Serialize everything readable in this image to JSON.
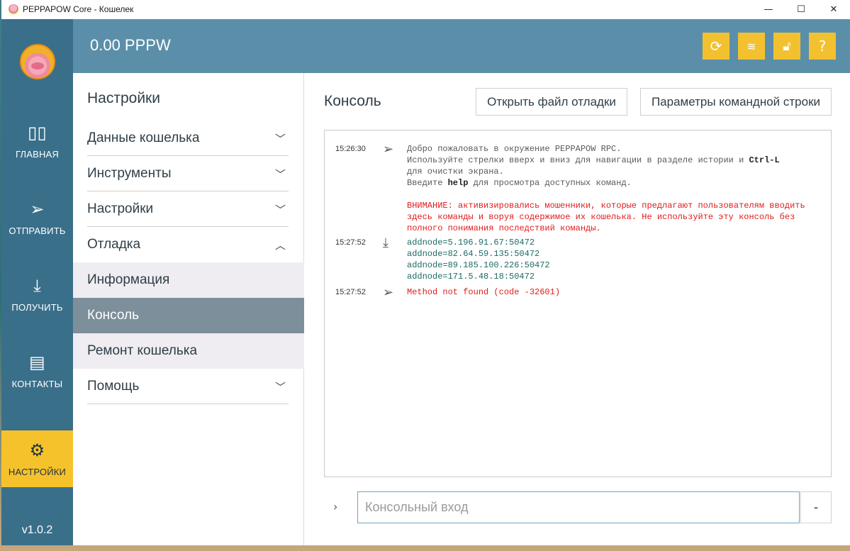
{
  "window": {
    "title": "PEPPAPOW Core - Кошелек",
    "minimize": "—",
    "maximize": "☐",
    "close": "✕"
  },
  "nav": {
    "items": [
      {
        "label": "ГЛАВНАЯ",
        "icon": "overview-icon"
      },
      {
        "label": "ОТПРАВИТЬ",
        "icon": "send-icon"
      },
      {
        "label": "ПОЛУЧИТЬ",
        "icon": "receive-icon"
      },
      {
        "label": "КОНТАКТЫ",
        "icon": "contacts-icon"
      },
      {
        "label": "НАСТРОЙКИ",
        "icon": "settings-icon"
      }
    ],
    "version": "v1.0.2"
  },
  "header": {
    "balance": "0.00 PPPW",
    "buttons": [
      "sync-icon",
      "network-icon",
      "lock-icon",
      "help-icon"
    ]
  },
  "settings": {
    "title": "Настройки",
    "sections": [
      {
        "label": "Данные кошелька"
      },
      {
        "label": "Инструменты"
      },
      {
        "label": "Настройки"
      },
      {
        "label": "Отладка"
      }
    ],
    "debug_items": [
      "Информация",
      "Консоль",
      "Ремонт кошелька"
    ],
    "help": "Помощь"
  },
  "console": {
    "title": "Консоль",
    "open_debug_file": "Открыть файл отладки",
    "cmdline_params": "Параметры командной строки",
    "entries": [
      {
        "time": "15:26:30",
        "icon": "send-icon",
        "welcome_line1": "Добро пожаловать в окружение PEPPAPOW RPC.",
        "welcome_line2a": "Используйте стрелки вверх и вниз для навигации в разделе истории и ",
        "welcome_line2_key": "Ctrl-L",
        "welcome_line3": "для очистки экрана.",
        "welcome_line4a": "Введите ",
        "welcome_line4_key": "help",
        "welcome_line4b": " для просмотра доступных команд.",
        "warning": "ВНИМАНИЕ: активизировались мошенники, которые предлагают пользователям вводить здесь команды и воруя содержимое их кошелька. Не используйте эту консоль без полного понимания последствий команды."
      },
      {
        "time": "15:27:52",
        "icon": "download-icon",
        "lines": [
          "addnode=5.196.91.67:50472",
          "addnode=82.64.59.135:50472",
          "addnode=89.185.100.226:50472",
          "addnode=171.5.48.18:50472"
        ]
      },
      {
        "time": "15:27:52",
        "icon": "send-icon",
        "error": "Method not found (code -32601)"
      }
    ],
    "prompt": "›",
    "input_placeholder": "Консольный вход",
    "clear_label": "-"
  }
}
